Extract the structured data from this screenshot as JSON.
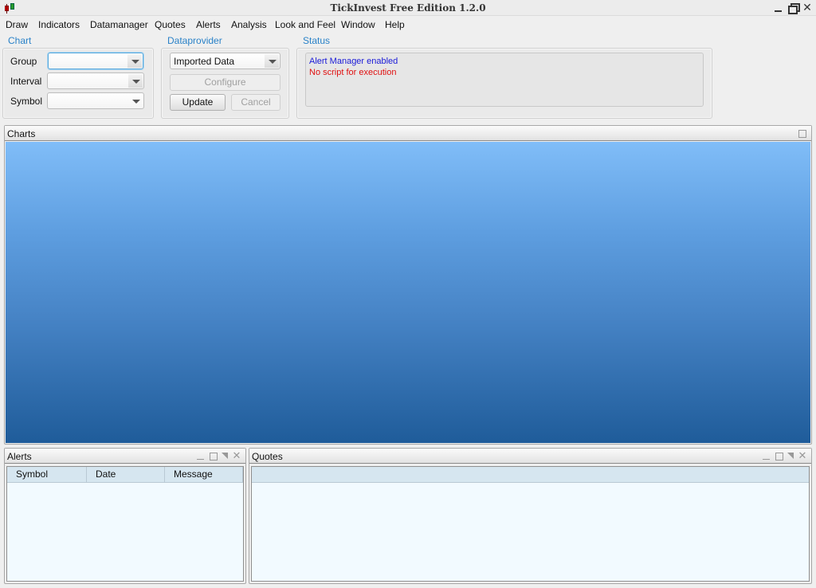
{
  "window": {
    "title": "TickInvest Free Edition 1.2.0",
    "icon": "candlestick-chart-icon",
    "controls": [
      "minimize",
      "restore",
      "close"
    ],
    "close_glyph": "✕"
  },
  "menu": {
    "items": [
      {
        "label": "Draw"
      },
      {
        "label": "Indicators"
      },
      {
        "label": "Datamanager"
      },
      {
        "label": "Quotes"
      },
      {
        "label": "Alerts"
      },
      {
        "label": "Analysis"
      },
      {
        "label": "Look and Feel"
      },
      {
        "label": "Window"
      },
      {
        "label": "Help"
      }
    ]
  },
  "chart_group": {
    "title": "Chart",
    "fields": [
      {
        "label": "Group",
        "value": ""
      },
      {
        "label": "Interval",
        "value": ""
      },
      {
        "label": "Symbol",
        "value": ""
      }
    ]
  },
  "dataprovider_group": {
    "title": "Dataprovider",
    "provider_value": "Imported Data",
    "configure_label": "Configure",
    "update_label": "Update",
    "cancel_label": "Cancel"
  },
  "status_group": {
    "title": "Status",
    "lines": [
      {
        "text": "Alert Manager enabled",
        "color": "#1a1ad8"
      },
      {
        "text": "No script for execution",
        "color": "#e01010"
      }
    ]
  },
  "charts_frame": {
    "title": "Charts"
  },
  "alerts_frame": {
    "title": "Alerts",
    "columns": [
      "Symbol",
      "Date",
      "Message"
    ],
    "rows": []
  },
  "quotes_frame": {
    "title": "Quotes",
    "columns": [],
    "rows": []
  },
  "frame_close_glyph": "✕"
}
